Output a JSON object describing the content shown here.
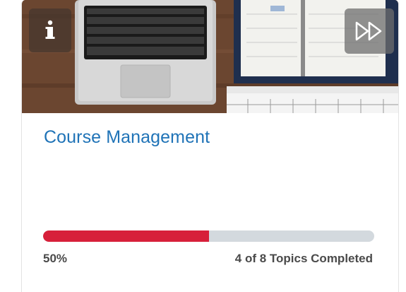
{
  "course": {
    "title": "Course Management",
    "progress_fraction": 0.5,
    "percent_label": "50%",
    "topics_label": "4 of 8 Topics Completed"
  },
  "icons": {
    "info": "info-icon",
    "skip": "fast-forward-icon"
  },
  "colors": {
    "title": "#1f73b7",
    "progress_fill": "#d7203a",
    "progress_track": "#d3d9de",
    "status_text": "#4a4a4a"
  }
}
